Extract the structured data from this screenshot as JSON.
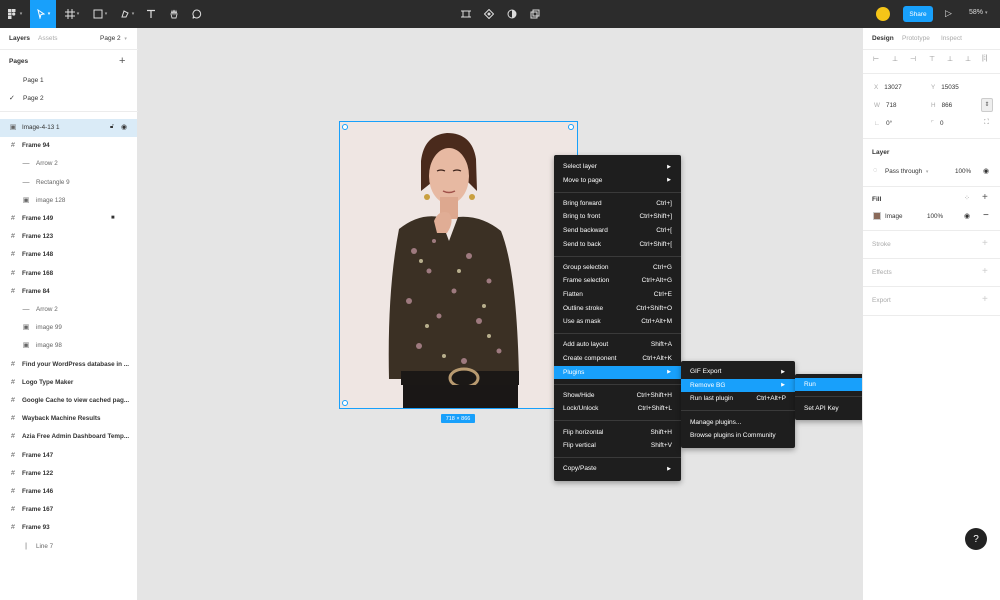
{
  "toolbar": {
    "share_label": "Share",
    "zoom_label": "58%",
    "icons": [
      "figma-menu-icon",
      "move-tool-icon",
      "frame-tool-icon",
      "shape-tool-icon",
      "pen-tool-icon",
      "text-tool-icon",
      "hand-tool-icon",
      "comment-tool-icon",
      "crop-icon",
      "component-icon",
      "mask-icon",
      "boolean-icon",
      "avatar",
      "play-icon"
    ]
  },
  "left_panel": {
    "tab_layers": "Layers",
    "tab_assets": "Assets",
    "page_selector": "Page 2",
    "pages_heading": "Pages",
    "pages": [
      {
        "label": "Page 1",
        "current": false
      },
      {
        "label": "Page 2",
        "current": true
      }
    ],
    "layers": [
      {
        "label": "Image-4-13 1",
        "icon": "image",
        "indent": 0,
        "bold": false,
        "selected": true
      },
      {
        "label": "Frame 94",
        "icon": "frame",
        "indent": 0,
        "bold": true,
        "selected": false
      },
      {
        "label": "Arrow 2",
        "icon": "line",
        "indent": 1,
        "bold": false,
        "selected": false
      },
      {
        "label": "Rectangle 9",
        "icon": "line",
        "indent": 1,
        "bold": false,
        "selected": false
      },
      {
        "label": "image 128",
        "icon": "image",
        "indent": 1,
        "bold": false,
        "selected": false
      },
      {
        "label": "Frame 149",
        "icon": "frame",
        "indent": 0,
        "bold": true,
        "selected": false,
        "locked": true
      },
      {
        "label": "Frame 123",
        "icon": "frame",
        "indent": 0,
        "bold": true,
        "selected": false
      },
      {
        "label": "Frame 148",
        "icon": "frame",
        "indent": 0,
        "bold": true,
        "selected": false
      },
      {
        "label": "Frame 168",
        "icon": "frame",
        "indent": 0,
        "bold": true,
        "selected": false
      },
      {
        "label": "Frame 84",
        "icon": "frame",
        "indent": 0,
        "bold": true,
        "selected": false
      },
      {
        "label": "Arrow 2",
        "icon": "line",
        "indent": 1,
        "bold": false,
        "selected": false
      },
      {
        "label": "image 99",
        "icon": "image",
        "indent": 1,
        "bold": false,
        "selected": false
      },
      {
        "label": "image 98",
        "icon": "image",
        "indent": 1,
        "bold": false,
        "selected": false
      },
      {
        "label": "Find your WordPress database in ...",
        "icon": "frame",
        "indent": 0,
        "bold": true,
        "selected": false
      },
      {
        "label": "Logo Type Maker",
        "icon": "frame",
        "indent": 0,
        "bold": true,
        "selected": false
      },
      {
        "label": "Google Cache to view cached pag...",
        "icon": "frame",
        "indent": 0,
        "bold": true,
        "selected": false
      },
      {
        "label": "Wayback Machine Results",
        "icon": "frame",
        "indent": 0,
        "bold": true,
        "selected": false
      },
      {
        "label": "Azia Free Admin Dashboard Temp...",
        "icon": "frame",
        "indent": 0,
        "bold": true,
        "selected": false
      },
      {
        "label": "Frame 147",
        "icon": "frame",
        "indent": 0,
        "bold": true,
        "selected": false
      },
      {
        "label": "Frame 122",
        "icon": "frame",
        "indent": 0,
        "bold": true,
        "selected": false
      },
      {
        "label": "Frame 146",
        "icon": "frame",
        "indent": 0,
        "bold": true,
        "selected": false
      },
      {
        "label": "Frame 167",
        "icon": "frame",
        "indent": 0,
        "bold": true,
        "selected": false
      },
      {
        "label": "Frame 93",
        "icon": "frame",
        "indent": 0,
        "bold": true,
        "selected": false
      },
      {
        "label": "Line 7",
        "icon": "vline",
        "indent": 1,
        "bold": false,
        "selected": false
      }
    ]
  },
  "canvas": {
    "dimension_label": "718 × 866"
  },
  "context_menu": {
    "groups": [
      [
        {
          "label": "Select layer",
          "shortcut": "",
          "submenu": true
        },
        {
          "label": "Move to page",
          "shortcut": "",
          "submenu": true
        }
      ],
      [
        {
          "label": "Bring forward",
          "shortcut": "Ctrl+]"
        },
        {
          "label": "Bring to front",
          "shortcut": "Ctrl+Shift+]"
        },
        {
          "label": "Send backward",
          "shortcut": "Ctrl+["
        },
        {
          "label": "Send to back",
          "shortcut": "Ctrl+Shift+["
        }
      ],
      [
        {
          "label": "Group selection",
          "shortcut": "Ctrl+G"
        },
        {
          "label": "Frame selection",
          "shortcut": "Ctrl+Alt+G"
        },
        {
          "label": "Flatten",
          "shortcut": "Ctrl+E"
        },
        {
          "label": "Outline stroke",
          "shortcut": "Ctrl+Shift+O"
        },
        {
          "label": "Use as mask",
          "shortcut": "Ctrl+Alt+M"
        }
      ],
      [
        {
          "label": "Add auto layout",
          "shortcut": "Shift+A"
        },
        {
          "label": "Create component",
          "shortcut": "Ctrl+Alt+K"
        },
        {
          "label": "Plugins",
          "shortcut": "",
          "submenu": true,
          "highlight": true
        }
      ],
      [
        {
          "label": "Show/Hide",
          "shortcut": "Ctrl+Shift+H"
        },
        {
          "label": "Lock/Unlock",
          "shortcut": "Ctrl+Shift+L"
        }
      ],
      [
        {
          "label": "Flip horizontal",
          "shortcut": "Shift+H"
        },
        {
          "label": "Flip vertical",
          "shortcut": "Shift+V"
        }
      ],
      [
        {
          "label": "Copy/Paste",
          "shortcut": "",
          "submenu": true
        }
      ]
    ]
  },
  "plugins_menu": {
    "groups": [
      [
        {
          "label": "GIF Export",
          "shortcut": "",
          "submenu": true
        },
        {
          "label": "Remove BG",
          "shortcut": "",
          "submenu": true,
          "highlight": true
        },
        {
          "label": "Run last plugin",
          "shortcut": "Ctrl+Alt+P"
        }
      ],
      [
        {
          "label": "Manage plugins...",
          "shortcut": ""
        },
        {
          "label": "Browse plugins in Community",
          "shortcut": ""
        }
      ]
    ]
  },
  "removebg_menu": {
    "groups": [
      [
        {
          "label": "Run",
          "shortcut": "",
          "highlight": true
        }
      ],
      [
        {
          "label": "Set API Key",
          "shortcut": ""
        }
      ]
    ]
  },
  "right_panel": {
    "tab_design": "Design",
    "tab_prototype": "Prototype",
    "tab_inspect": "Inspect",
    "x_label": "X",
    "x_value": "13027",
    "y_label": "Y",
    "y_value": "15035",
    "w_label": "W",
    "w_value": "718",
    "h_label": "H",
    "h_value": "866",
    "rotation_value": "0°",
    "radius_value": "0",
    "layer_heading": "Layer",
    "blend_mode": "Pass through",
    "layer_opacity": "100%",
    "fill_heading": "Fill",
    "fill_type": "Image",
    "fill_opacity": "100%",
    "stroke_heading": "Stroke",
    "effects_heading": "Effects",
    "export_heading": "Export"
  },
  "colors": {
    "accent": "#18a0fb",
    "toolbar_bg": "#2c2c2c",
    "menu_bg": "#1e1e1e",
    "canvas_bg": "#e5e5e5",
    "selected_layer_bg": "#daebf7"
  }
}
